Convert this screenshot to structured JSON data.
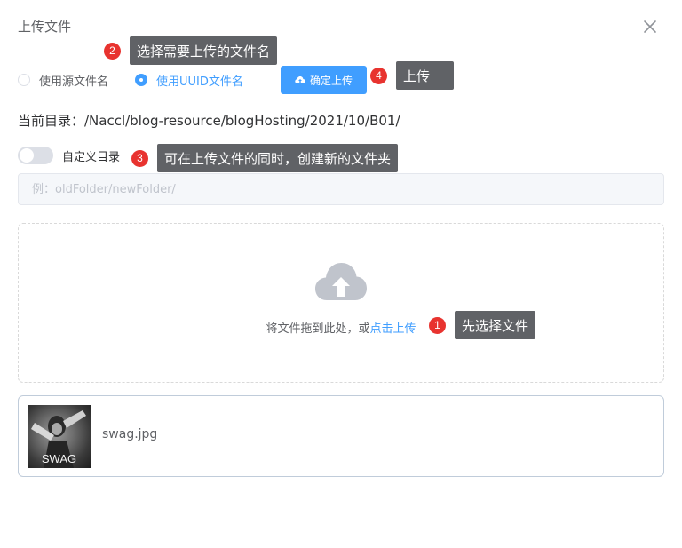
{
  "dialog": {
    "title": "上传文件"
  },
  "naming": {
    "options": [
      {
        "label": "使用源文件名",
        "checked": false
      },
      {
        "label": "使用UUID文件名",
        "checked": true
      }
    ]
  },
  "upload_button": {
    "label": "确定上传"
  },
  "current_directory": {
    "text": "当前目录：/Naccl/blog-resource/blogHosting/2021/10/B01/"
  },
  "custom_dir": {
    "label": "自定义目录",
    "enabled": false
  },
  "dir_input": {
    "placeholder": "例：oldFolder/newFolder/",
    "value": ""
  },
  "drop_zone": {
    "text": "将文件拖到此处，或",
    "link": "点击上传"
  },
  "file": {
    "name": "swag.jpg",
    "thumbnail_text": "SWAG"
  },
  "annotations": [
    {
      "number": "1",
      "text": "先选择文件"
    },
    {
      "number": "2",
      "text": "选择需要上传的文件名"
    },
    {
      "number": "3",
      "text": "可在上传文件的同时，创建新的文件夹"
    },
    {
      "number": "4",
      "text": "上传"
    }
  ],
  "colors": {
    "primary": "#409eff",
    "badge": "#e8332f",
    "tooltip": "#606266"
  }
}
